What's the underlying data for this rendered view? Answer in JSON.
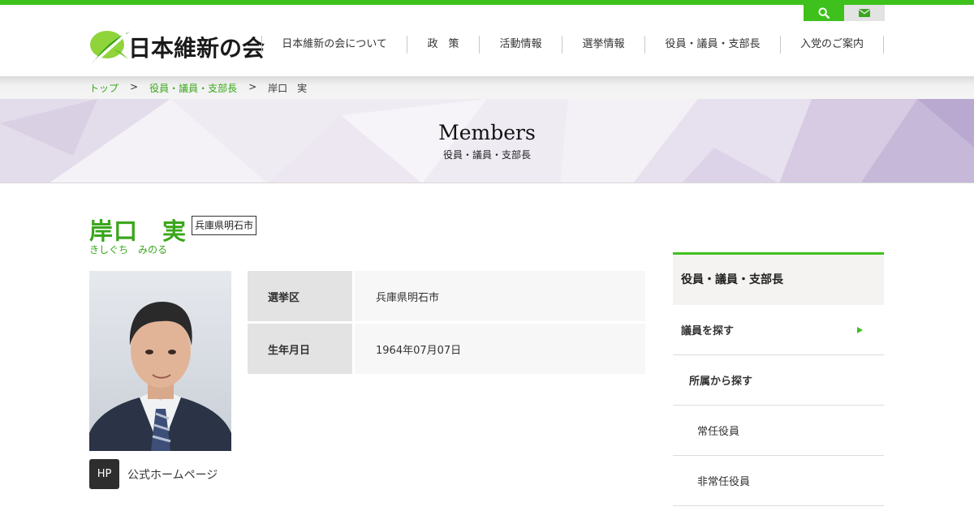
{
  "header": {
    "logo_text": "日本維新の会",
    "nav": [
      {
        "label": "日本維新の会について"
      },
      {
        "label": "政　策"
      },
      {
        "label": "活動情報"
      },
      {
        "label": "選挙情報"
      },
      {
        "label": "役員・議員・支部長"
      },
      {
        "label": "入党のご案内"
      }
    ],
    "utility": {
      "search_icon": "search-icon",
      "mail_icon": "mail-icon"
    }
  },
  "breadcrumb": {
    "items": [
      "トップ",
      "役員・議員・支部長",
      "岸口　実"
    ],
    "separator": ">"
  },
  "hero": {
    "title": "Members",
    "subtitle": "役員・議員・支部長"
  },
  "profile": {
    "name": "岸口　実",
    "kana": "きしぐち　みのる",
    "region": "兵庫県明石市",
    "hp_badge": "HP",
    "hp_label": "公式ホームページ",
    "details": [
      {
        "label": "選挙区",
        "value": "兵庫県明石市"
      },
      {
        "label": "生年月日",
        "value": "1964年07月07日"
      }
    ]
  },
  "sidebar": {
    "title": "役員・議員・支部長",
    "items": [
      {
        "label": "議員を探す"
      },
      {
        "label": "所属から探す"
      },
      {
        "label": "常任役員"
      },
      {
        "label": "非常任役員"
      }
    ]
  },
  "colors": {
    "brand_green": "#3ec11c",
    "link_green": "#3aa61c"
  }
}
